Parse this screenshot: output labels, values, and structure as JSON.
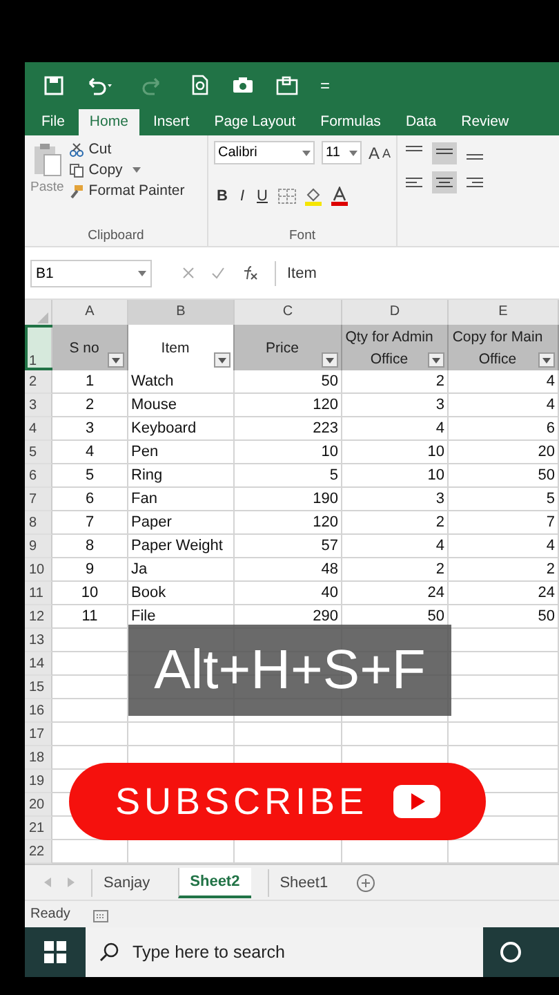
{
  "quick_access": {
    "customize": "="
  },
  "ribbon_tabs": [
    {
      "label": "File",
      "selected": false
    },
    {
      "label": "Home",
      "selected": true
    },
    {
      "label": "Insert",
      "selected": false
    },
    {
      "label": "Page Layout",
      "selected": false
    },
    {
      "label": "Formulas",
      "selected": false
    },
    {
      "label": "Data",
      "selected": false
    },
    {
      "label": "Review",
      "selected": false
    }
  ],
  "clipboard": {
    "paste": "Paste",
    "cut": "Cut",
    "copy": "Copy",
    "format_painter": "Format Painter",
    "group_label": "Clipboard"
  },
  "font": {
    "name": "Calibri",
    "size": "11",
    "grow": "A",
    "shrink": "A",
    "bold": "B",
    "italic": "I",
    "underline": "U",
    "group_label": "Font"
  },
  "formula_bar": {
    "name_box": "B1",
    "value": "Item"
  },
  "columns": [
    {
      "label": "A",
      "selected": false
    },
    {
      "label": "B",
      "selected": true
    },
    {
      "label": "C",
      "selected": false
    },
    {
      "label": "D",
      "selected": false
    },
    {
      "label": "E",
      "selected": false
    }
  ],
  "header_row": {
    "number": "1",
    "cells": [
      {
        "text": "S no",
        "selected": false
      },
      {
        "text": "Item",
        "selected": true
      },
      {
        "text": "Price",
        "selected": false
      },
      {
        "text": "Qty for Admin Office",
        "selected": false
      },
      {
        "text": "Copy for Main Office",
        "selected": false
      }
    ]
  },
  "rows": [
    {
      "number": "2",
      "cells": [
        "1",
        "Watch",
        "50",
        "2",
        "4"
      ]
    },
    {
      "number": "3",
      "cells": [
        "2",
        "Mouse",
        "120",
        "3",
        "4"
      ]
    },
    {
      "number": "4",
      "cells": [
        "3",
        "Keyboard",
        "223",
        "4",
        "6"
      ]
    },
    {
      "number": "5",
      "cells": [
        "4",
        "Pen",
        "10",
        "10",
        "20"
      ]
    },
    {
      "number": "6",
      "cells": [
        "5",
        "Ring",
        "5",
        "10",
        "50"
      ]
    },
    {
      "number": "7",
      "cells": [
        "6",
        "Fan",
        "190",
        "3",
        "5"
      ]
    },
    {
      "number": "8",
      "cells": [
        "7",
        "Paper",
        "120",
        "2",
        "7"
      ]
    },
    {
      "number": "9",
      "cells": [
        "8",
        "Paper Weight",
        "57",
        "4",
        "4"
      ]
    },
    {
      "number": "10",
      "cells": [
        "9",
        "Ja",
        "48",
        "2",
        "2"
      ]
    },
    {
      "number": "11",
      "cells": [
        "10",
        "Book",
        "40",
        "24",
        "24"
      ]
    },
    {
      "number": "12",
      "cells": [
        "11",
        "File",
        "290",
        "50",
        "50"
      ]
    },
    {
      "number": "13",
      "cells": []
    },
    {
      "number": "14",
      "cells": []
    },
    {
      "number": "15",
      "cells": []
    },
    {
      "number": "16",
      "cells": []
    },
    {
      "number": "17",
      "cells": []
    },
    {
      "number": "18",
      "cells": []
    },
    {
      "number": "19",
      "cells": []
    },
    {
      "number": "20",
      "cells": []
    },
    {
      "number": "21",
      "cells": []
    },
    {
      "number": "22",
      "cells": []
    }
  ],
  "sheet_tabs": [
    {
      "label": "Sanjay",
      "selected": false
    },
    {
      "label": "Sheet2",
      "selected": true
    },
    {
      "label": "Sheet1",
      "selected": false
    }
  ],
  "status_bar": {
    "text": "Ready"
  },
  "taskbar": {
    "search_placeholder": "Type here to search"
  },
  "caption": "Alt+H+S+F",
  "subscribe_button": "SUBSCRIBE"
}
